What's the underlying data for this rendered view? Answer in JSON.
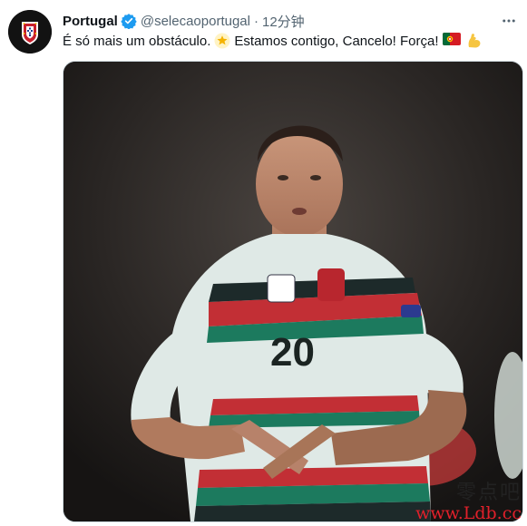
{
  "tweet": {
    "author_name": "Portugal",
    "handle": "@selecaoportugal",
    "separator": "·",
    "time": "12分钟",
    "text_part1": "É só mais um obstáculo.",
    "text_part2": "Estamos contigo, Cancelo! Força!",
    "icons": [
      "verified-badge-icon",
      "more-options-icon",
      "star-emoji",
      "portugal-flag-emoji",
      "flexed-biceps-emoji"
    ]
  },
  "image": {
    "jersey_number": "20"
  },
  "watermark": {
    "line1": "零点吧",
    "line2": "www.Ldb.cc"
  },
  "colors": {
    "verified_blue": "#1d9bf0",
    "text_primary": "#0f1419",
    "text_secondary": "#536471",
    "watermark_red": "#e0202a"
  }
}
